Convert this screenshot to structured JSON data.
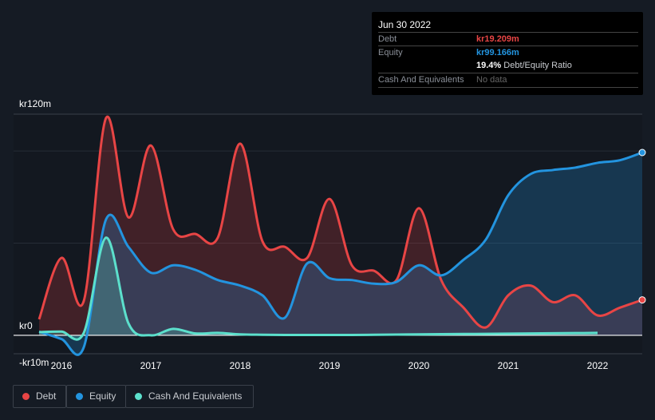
{
  "tooltip": {
    "date": "Jun 30 2022",
    "debt_label": "Debt",
    "debt_value": "kr19.209m",
    "equity_label": "Equity",
    "equity_value": "kr99.166m",
    "ratio_value": "19.4%",
    "ratio_label": "Debt/Equity Ratio",
    "cash_label": "Cash And Equivalents",
    "cash_value": "No data"
  },
  "legend": [
    "Debt",
    "Equity",
    "Cash And Equivalents"
  ],
  "chart_data": {
    "type": "area",
    "ylim": [
      -10,
      120
    ],
    "y_tick_labels": [
      {
        "value": 120,
        "label": "kr120m"
      },
      {
        "value": 0,
        "label": "kr0"
      },
      {
        "value": -10,
        "label": "-kr10m"
      }
    ],
    "x_tick_labels": [
      "2016",
      "2017",
      "2018",
      "2019",
      "2020",
      "2021",
      "2022"
    ],
    "x": [
      2015.75,
      2016,
      2016.25,
      2016.5,
      2016.75,
      2017,
      2017.25,
      2017.5,
      2017.75,
      2018,
      2018.25,
      2018.5,
      2018.75,
      2019,
      2019.25,
      2019.5,
      2019.75,
      2020,
      2020.25,
      2020.5,
      2020.75,
      2021,
      2021.25,
      2021.5,
      2021.75,
      2022,
      2022.25,
      2022.5
    ],
    "series": [
      {
        "name": "Debt",
        "color": "#e84545",
        "values": [
          8.7,
          42,
          18.6,
          118,
          64,
          103,
          57.6,
          55,
          53,
          104,
          51,
          48,
          42,
          74,
          38,
          35,
          30,
          69,
          30,
          15,
          4.3,
          21.7,
          27,
          18,
          21.7,
          10.8,
          15,
          19.2
        ]
      },
      {
        "name": "Equity",
        "color": "#2394df",
        "values": [
          2,
          -2,
          -6.5,
          63,
          48,
          34,
          38,
          35.5,
          30,
          27,
          21.7,
          9.5,
          39,
          31,
          30,
          28,
          29,
          38,
          32.5,
          41,
          52,
          76,
          87.5,
          89.7,
          91,
          93.6,
          95,
          99.2
        ]
      },
      {
        "name": "Cash And Equivalents",
        "color": "#5ce0cc",
        "values": [
          1.7,
          2,
          1.3,
          53,
          6.5,
          0,
          3.5,
          1,
          1.3,
          0.5,
          0.3,
          0.2,
          0.2,
          0.2,
          0.2,
          0.3,
          0.4,
          0.5,
          0.6,
          0.7,
          0.8,
          0.9,
          1,
          1.1,
          1.2,
          1.3,
          null,
          null
        ]
      }
    ]
  }
}
